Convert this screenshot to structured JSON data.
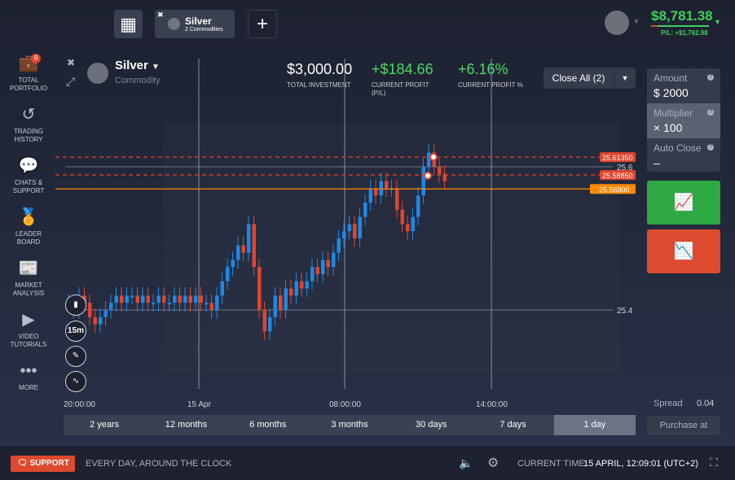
{
  "header": {
    "tab_title": "Silver",
    "tab_subtitle": "2 Commodities",
    "balance": "$8,781.38",
    "pl": "P/L: +$1,762.98"
  },
  "sidebar": [
    {
      "label": "TOTAL PORTFOLIO",
      "icon": "briefcase-icon",
      "badge": "9"
    },
    {
      "label": "TRADING HISTORY",
      "icon": "history-icon"
    },
    {
      "label": "CHATS & SUPPORT",
      "icon": "chat-icon"
    },
    {
      "label": "LEADER BOARD",
      "icon": "award-icon"
    },
    {
      "label": "MARKET ANALYSIS",
      "icon": "news-icon"
    },
    {
      "label": "VIDEO TUTORIALS",
      "icon": "play-icon"
    },
    {
      "label": "MORE",
      "icon": "more-icon"
    }
  ],
  "asset": {
    "name": "Silver",
    "type": "Commodity"
  },
  "stats": [
    {
      "value": "$3,000.00",
      "label": "TOTAL INVESTMENT",
      "color": "#ffffff"
    },
    {
      "value": "+$184.66",
      "label": "CURRENT PROFIT (P/L)",
      "color": "#4cd964"
    },
    {
      "value": "+6.16%",
      "label": "CURRENT PROFIT %",
      "color": "#4cd964"
    }
  ],
  "close_all": "Close All (2)",
  "panel": {
    "amount_label": "Amount",
    "amount": "$  2000",
    "multiplier_label": "Multiplier",
    "multiplier": "× 100",
    "autoclose_label": "Auto Close",
    "autoclose": "–",
    "spread_label": "Spread",
    "spread": "0.04",
    "purchase": "Purchase at"
  },
  "tools": {
    "timeframe": "15m"
  },
  "chart_data": {
    "type": "candlestick",
    "y_ticks": [
      "25.6",
      "25.4"
    ],
    "x_ticks": [
      "20:00:00",
      "15 Apr",
      "08:00:00",
      "14:00:00"
    ],
    "levels": [
      {
        "value": "25.61350",
        "color": "#e0452e",
        "style": "dashed"
      },
      {
        "value": "25.58850",
        "color": "#e0452e",
        "style": "dashed"
      },
      {
        "value": "25.56900",
        "color": "#ff8a00",
        "style": "solid"
      }
    ],
    "closes": [
      25.41,
      25.4,
      25.42,
      25.41,
      25.39,
      25.38,
      25.39,
      25.4,
      25.41,
      25.42,
      25.41,
      25.42,
      25.42,
      25.41,
      25.42,
      25.41,
      25.41,
      25.42,
      25.41,
      25.41,
      25.42,
      25.41,
      25.42,
      25.41,
      25.42,
      25.41,
      25.41,
      25.4,
      25.42,
      25.44,
      25.46,
      25.47,
      25.49,
      25.48,
      25.52,
      25.46,
      25.4,
      25.37,
      25.39,
      25.42,
      25.4,
      25.43,
      25.42,
      25.44,
      25.43,
      25.44,
      25.46,
      25.45,
      25.47,
      25.46,
      25.48,
      25.5,
      25.51,
      25.52,
      25.5,
      25.53,
      25.55,
      25.57,
      25.56,
      25.58,
      25.57,
      25.57,
      25.54,
      25.52,
      25.51,
      25.53,
      25.56,
      25.6,
      25.62,
      25.6,
      25.59,
      25.58
    ]
  },
  "periods": [
    "2 years",
    "12 months",
    "6 months",
    "3 months",
    "30 days",
    "7 days",
    "1 day"
  ],
  "active_period": 6,
  "footer": {
    "support": "SUPPORT",
    "tagline": "EVERY DAY, AROUND THE CLOCK",
    "time_label": "CURRENT TIME:",
    "time": "15 APRIL, 12:09:01 (UTC+2)"
  }
}
